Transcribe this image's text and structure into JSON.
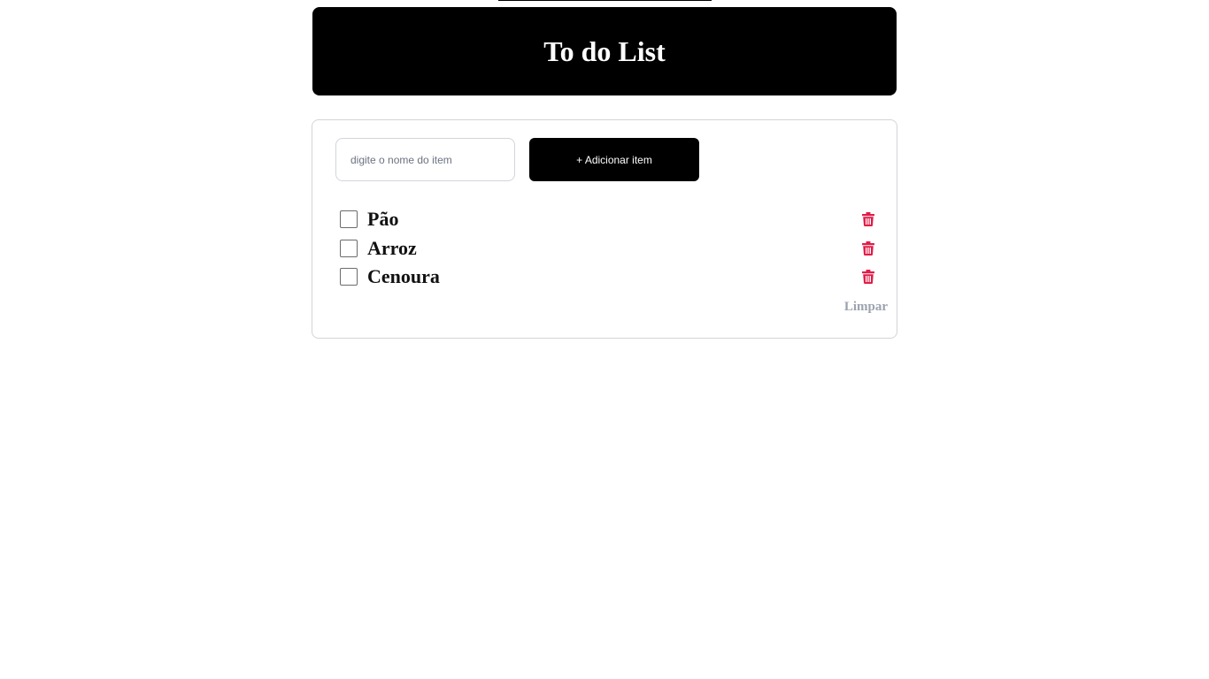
{
  "header": {
    "title": "To do List"
  },
  "form": {
    "placeholder": "digite o nome do item",
    "value": "",
    "add_label": "+ Adicionar item"
  },
  "items": [
    {
      "label": "Pão",
      "checked": false
    },
    {
      "label": "Arroz",
      "checked": false
    },
    {
      "label": "Cenoura",
      "checked": false
    }
  ],
  "actions": {
    "clear_label": "Limpar"
  },
  "icons": {
    "delete": "trash-icon"
  },
  "colors": {
    "header_bg": "#000000",
    "header_text": "#ffffff",
    "delete_icon": "#e11d48",
    "clear_text": "#9ca3af",
    "card_border": "#d4d4d8"
  }
}
